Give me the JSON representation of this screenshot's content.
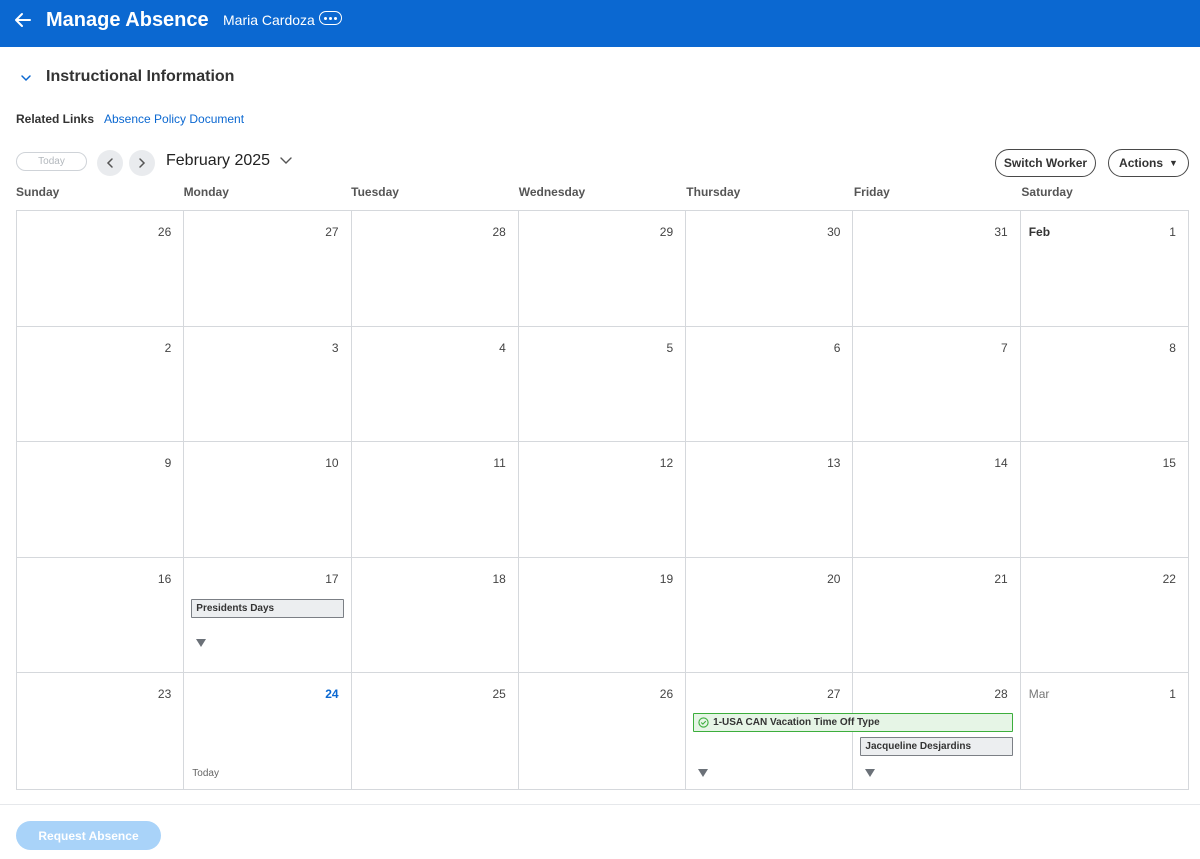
{
  "header": {
    "title": "Manage Absence",
    "worker_name": "Maria Cardoza"
  },
  "section": {
    "title": "Instructional Information"
  },
  "related": {
    "label": "Related Links",
    "link": "Absence Policy Document"
  },
  "toolbar": {
    "today_label": "Today",
    "month": "February 2025",
    "switch_worker_label": "Switch Worker",
    "actions_label": "Actions"
  },
  "weekdays": [
    "Sunday",
    "Monday",
    "Tuesday",
    "Wednesday",
    "Thursday",
    "Friday",
    "Saturday"
  ],
  "weeks": [
    [
      {
        "day": "26"
      },
      {
        "day": "27"
      },
      {
        "day": "28"
      },
      {
        "day": "29"
      },
      {
        "day": "30"
      },
      {
        "day": "31"
      },
      {
        "day": "1",
        "month": "Feb"
      }
    ],
    [
      {
        "day": "2"
      },
      {
        "day": "3"
      },
      {
        "day": "4"
      },
      {
        "day": "5"
      },
      {
        "day": "6"
      },
      {
        "day": "7"
      },
      {
        "day": "8"
      }
    ],
    [
      {
        "day": "9"
      },
      {
        "day": "10"
      },
      {
        "day": "11"
      },
      {
        "day": "12"
      },
      {
        "day": "13"
      },
      {
        "day": "14"
      },
      {
        "day": "15"
      }
    ],
    [
      {
        "day": "16"
      },
      {
        "day": "17"
      },
      {
        "day": "18"
      },
      {
        "day": "19"
      },
      {
        "day": "20"
      },
      {
        "day": "21"
      },
      {
        "day": "22"
      }
    ],
    [
      {
        "day": "23"
      },
      {
        "day": "24",
        "today": true,
        "today_label": "Today"
      },
      {
        "day": "25"
      },
      {
        "day": "26"
      },
      {
        "day": "27"
      },
      {
        "day": "28"
      },
      {
        "day": "1",
        "month": "Mar"
      }
    ]
  ],
  "events": {
    "presidents_day": "Presidents Days",
    "vacation": "1-USA CAN Vacation Time Off Type",
    "jacqueline": "Jacqueline Desjardins"
  },
  "footer": {
    "request_label": "Request Absence"
  },
  "colors": {
    "brand": "#0b68d1",
    "vacation_border": "#3cae3c",
    "request_button": "#a9d3f9"
  }
}
